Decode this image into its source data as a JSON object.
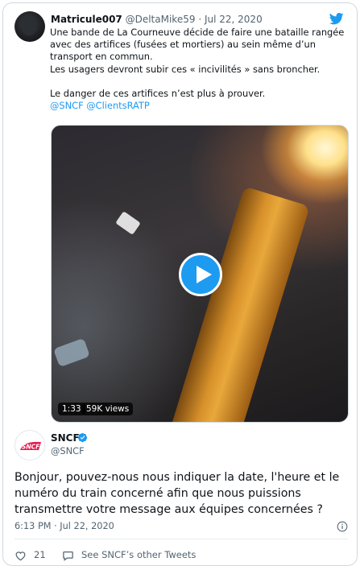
{
  "quoted_tweet": {
    "author_name": "Matricule007",
    "author_handle": "@DeltaMike59",
    "separator": "·",
    "date": "Jul 22, 2020",
    "paragraphs": [
      "Une bande de La Courneuve décide de faire une bataille rangée avec des artifices (fusées et mortiers) au sein même d’un transport en commun.",
      "Les usagers devront subir ces « incivilités » sans broncher.",
      "Le danger de ces artifices n’est plus à prouver."
    ],
    "mentions": "@SNCF @ClientsRATP",
    "video": {
      "duration": "1:33",
      "views": "59K views"
    }
  },
  "reply_tweet": {
    "author_name": "SNCF",
    "author_handle": "@SNCF",
    "avatar_text": "SNCF",
    "text": "Bonjour, pouvez-nous nous indiquer la date, l'heure et le numéro du train concerné afin que nous puissions transmettre votre message aux équipes concernées  ?",
    "timestamp": "6:13 PM · Jul 22, 2020",
    "likes": "21",
    "see_more_label": "See SNCF’s other Tweets"
  },
  "colors": {
    "accent": "#1d9bf0",
    "sncf_red": "#e4003b",
    "muted_text": "#536471"
  },
  "icons": [
    "twitter-bird-icon",
    "play-icon",
    "verified-badge-icon",
    "info-icon",
    "heart-icon",
    "reply-bubble-icon"
  ]
}
